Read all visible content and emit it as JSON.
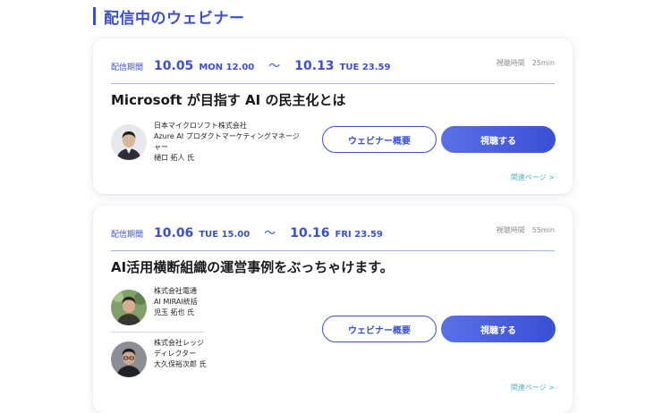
{
  "section": {
    "title": "配信中のウェビナー"
  },
  "webinars": [
    {
      "period_label": "配信期間",
      "start_date": "10.05",
      "start_dt": "MON 12.00",
      "separator": "〜",
      "end_date": "10.13",
      "end_dt": "TUE 23.59",
      "duration_label": "視聴時間",
      "duration": "25min",
      "title": "Microsoft が目指す AI の民主化とは",
      "speakers": [
        {
          "company": "日本マイクロソフト株式会社",
          "role_line1": "Azure AI プロダクトマーケティングマネージ",
          "role_line2": "ャー",
          "name": "樋口 拓人 氏"
        }
      ],
      "outline_button": "ウェビナー概要",
      "watch_button": "視聴する",
      "related_link": "関連ページ >"
    },
    {
      "period_label": "配信期間",
      "start_date": "10.06",
      "start_dt": "TUE 15.00",
      "separator": "〜",
      "end_date": "10.16",
      "end_dt": "FRI 23.59",
      "duration_label": "視聴時間",
      "duration": "55min",
      "title": "AI活用横断組織の運営事例をぶっちゃけます。",
      "speakers": [
        {
          "company": "株式会社電通",
          "role_line1": "AI MIRAI統括",
          "name": "児玉 拓也 氏"
        },
        {
          "company": "株式会社レッジ",
          "role_line1": "ディレクター",
          "name": "大久保裕次郎 氏"
        }
      ],
      "outline_button": "ウェビナー概要",
      "watch_button": "視聴する",
      "related_link": "関連ページ >"
    }
  ]
}
